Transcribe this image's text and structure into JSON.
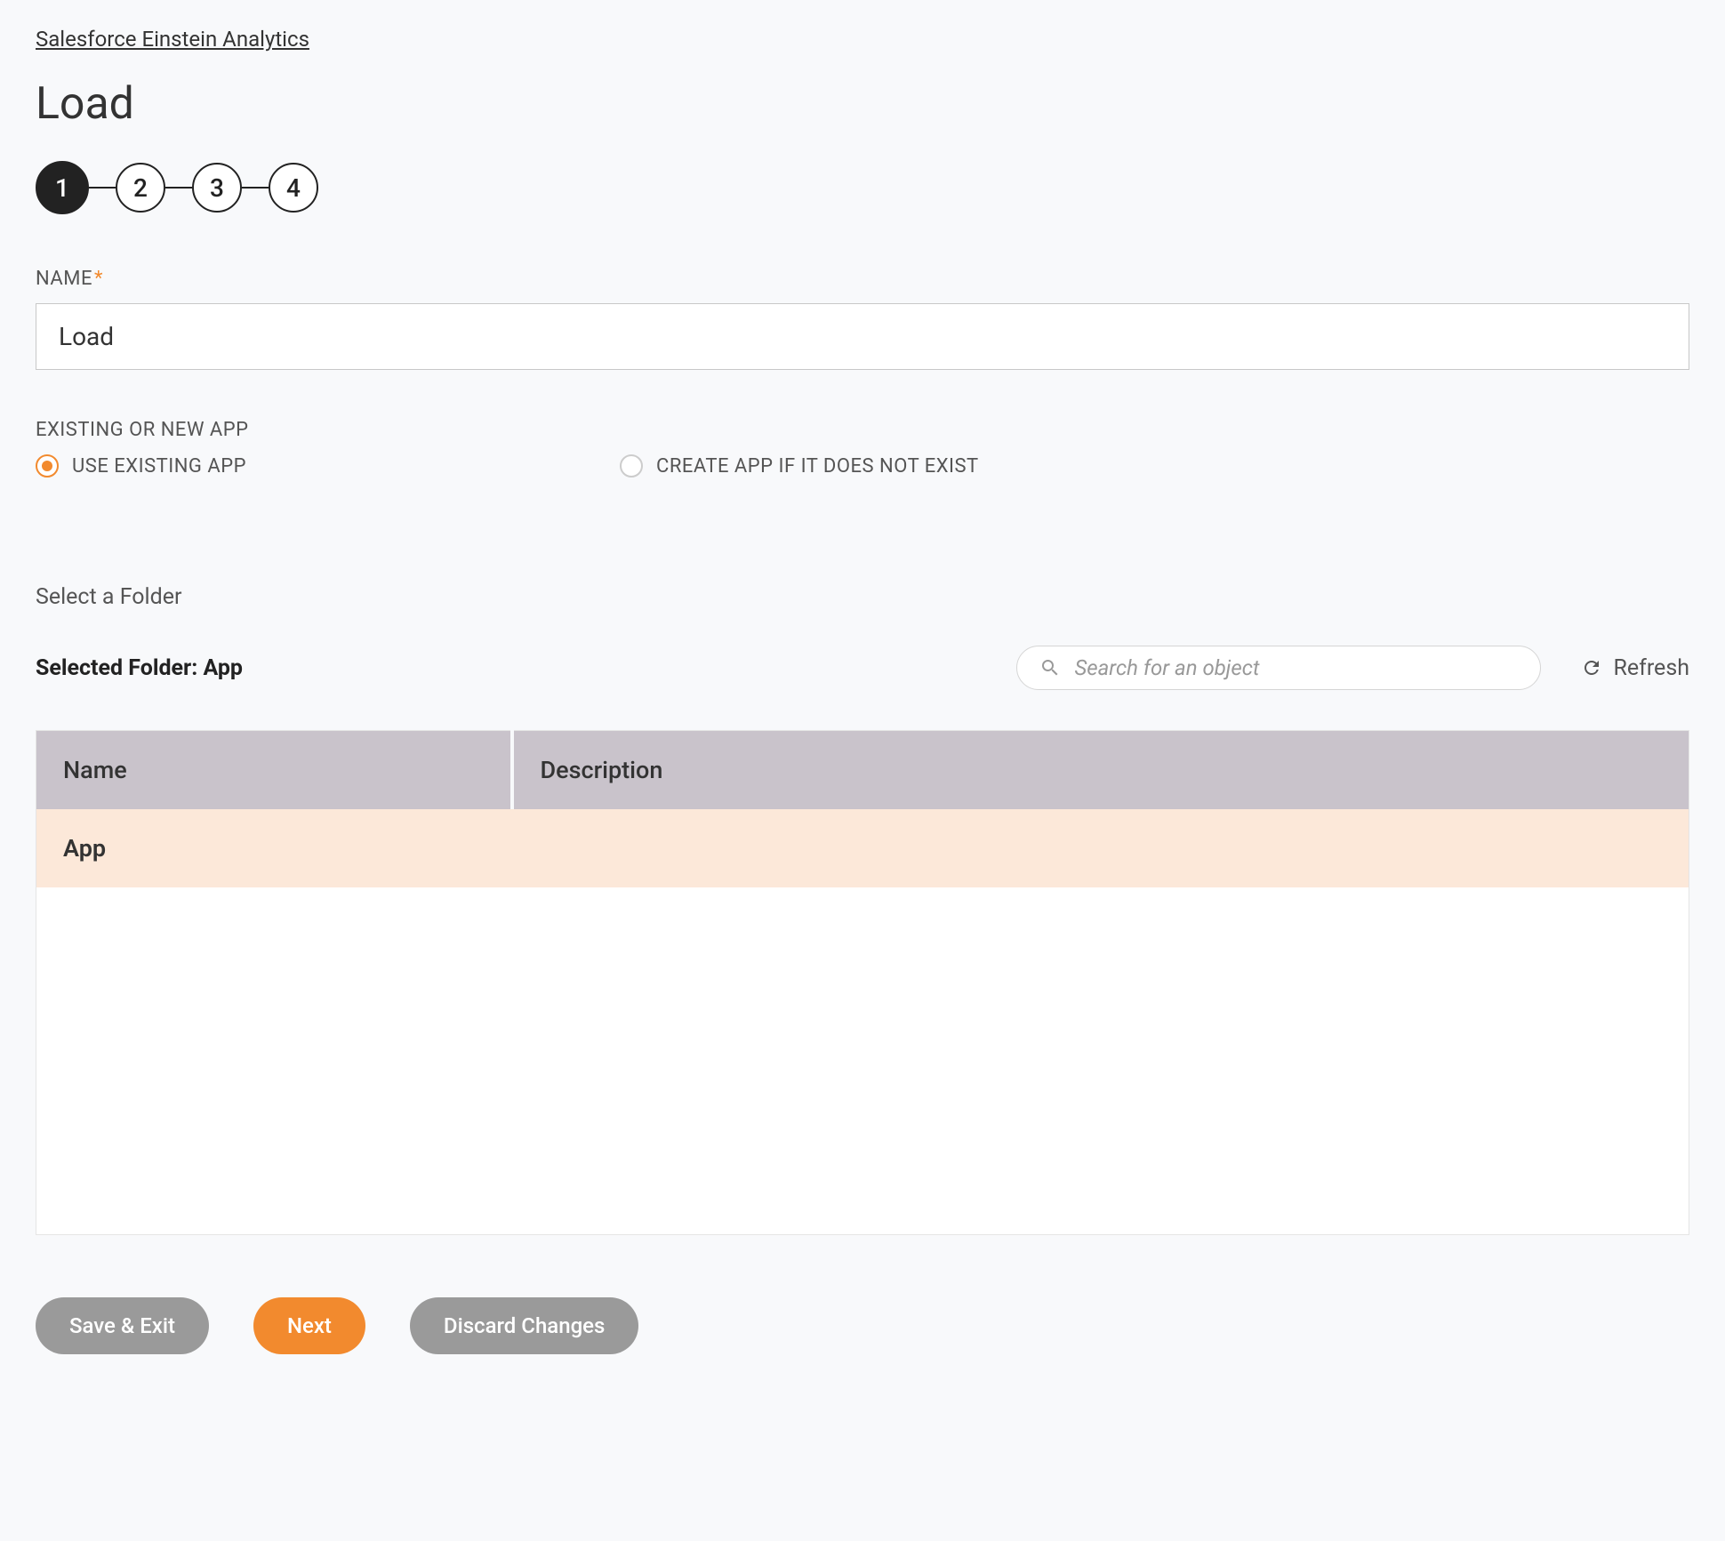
{
  "breadcrumb": "Salesforce Einstein Analytics",
  "page_title": "Load",
  "steps": [
    "1",
    "2",
    "3",
    "4"
  ],
  "active_step": 0,
  "name_field": {
    "label": "NAME",
    "value": "Load"
  },
  "app_choice": {
    "label": "EXISTING OR NEW APP",
    "options": [
      {
        "label": "USE EXISTING APP",
        "selected": true
      },
      {
        "label": "CREATE APP IF IT DOES NOT EXIST",
        "selected": false
      }
    ]
  },
  "folder_section": {
    "label": "Select a Folder",
    "selected_prefix": "Selected Folder: ",
    "selected_value": "App",
    "search_placeholder": "Search for an object",
    "refresh_label": "Refresh"
  },
  "table": {
    "headers": [
      "Name",
      "Description"
    ],
    "rows": [
      {
        "name": "App",
        "description": ""
      }
    ]
  },
  "buttons": {
    "save_exit": "Save & Exit",
    "next": "Next",
    "discard": "Discard Changes"
  }
}
